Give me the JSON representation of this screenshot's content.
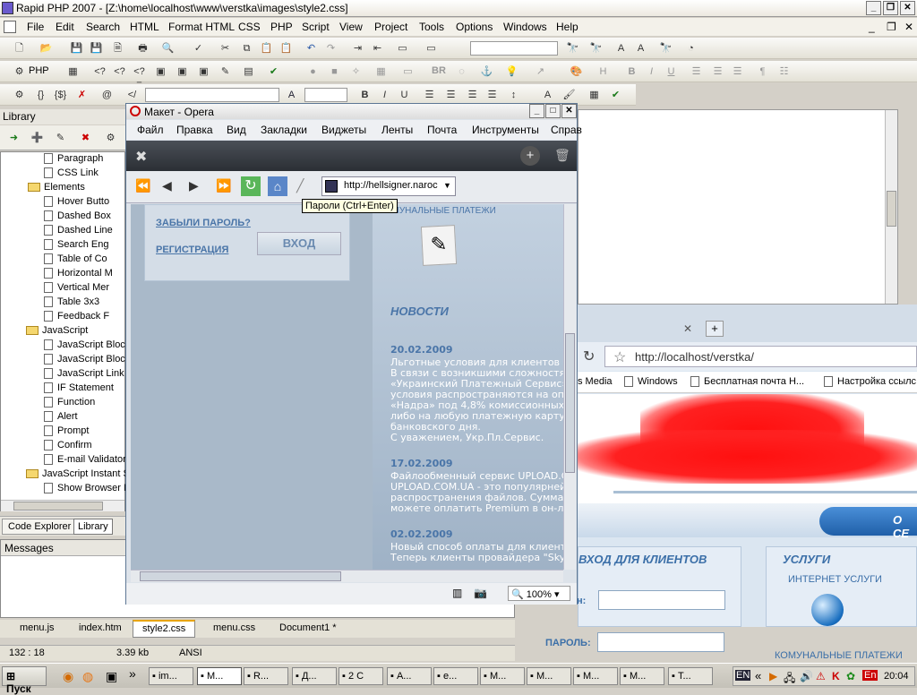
{
  "app": {
    "title": "Rapid PHP 2007 - [Z:\\home\\localhost\\www\\verstka\\images\\style2.css]",
    "menu": [
      "File",
      "Edit",
      "Search",
      "HTML",
      "Format HTML",
      "CSS",
      "PHP",
      "Script",
      "View",
      "Project",
      "Tools",
      "Options",
      "Windows",
      "Help"
    ],
    "toolbar2_labels": {
      "php": "PHP",
      "br": "BR"
    }
  },
  "library": {
    "title": "Library",
    "items": [
      {
        "label": "Paragraph",
        "type": "doc",
        "indent": 2
      },
      {
        "label": "CSS Link",
        "type": "doc",
        "indent": 2
      },
      {
        "label": "Elements",
        "type": "folder",
        "indent": 1
      },
      {
        "label": "Hover Butto",
        "type": "doc",
        "indent": 2
      },
      {
        "label": "Dashed Box",
        "type": "doc",
        "indent": 2
      },
      {
        "label": "Dashed Line",
        "type": "doc",
        "indent": 2
      },
      {
        "label": "Search Eng",
        "type": "doc",
        "indent": 2
      },
      {
        "label": "Table of Co",
        "type": "doc",
        "indent": 2
      },
      {
        "label": "Horizontal M",
        "type": "doc",
        "indent": 2
      },
      {
        "label": "Vertical Mer",
        "type": "doc",
        "indent": 2
      },
      {
        "label": "Table 3x3",
        "type": "doc",
        "indent": 2
      },
      {
        "label": "Feedback F",
        "type": "doc",
        "indent": 2
      },
      {
        "label": "JavaScript",
        "type": "folder",
        "indent": 0
      },
      {
        "label": "JavaScript Block",
        "type": "doc",
        "indent": 2
      },
      {
        "label": "JavaScript Block",
        "type": "doc",
        "indent": 2
      },
      {
        "label": "JavaScript Link",
        "type": "doc",
        "indent": 2
      },
      {
        "label": "IF Statement",
        "type": "doc",
        "indent": 2
      },
      {
        "label": "Function",
        "type": "doc",
        "indent": 2
      },
      {
        "label": "Alert",
        "type": "doc",
        "indent": 2
      },
      {
        "label": "Prompt",
        "type": "doc",
        "indent": 2
      },
      {
        "label": "Confirm",
        "type": "doc",
        "indent": 2
      },
      {
        "label": "E-mail Validator",
        "type": "doc",
        "indent": 2
      },
      {
        "label": "JavaScript Instant S",
        "type": "folder",
        "indent": 0
      },
      {
        "label": "Show Browser I",
        "type": "doc",
        "indent": 2
      }
    ],
    "bottom_tabs": [
      "Code Explorer",
      "Library"
    ]
  },
  "messages": {
    "title": "Messages"
  },
  "doc_tabs": [
    "menu.js",
    "index.htm",
    "style2.css",
    "menu.css",
    "Document1 *"
  ],
  "status": {
    "position": "132 : 18",
    "size": "3.39 kb",
    "encoding": "ANSI"
  },
  "opera": {
    "title": "Макет - Opera",
    "menu": [
      "Файл",
      "Правка",
      "Вид",
      "Закладки",
      "Виджеты",
      "Ленты",
      "Почта",
      "Инструменты",
      "Справ"
    ],
    "address": "http://hellsigner.naroc",
    "tooltip": "Пароли (Ctrl+Enter)",
    "zoom": "100%",
    "page": {
      "forgot": "ЗАБЫЛИ ПАРОЛЬ?",
      "register": "РЕГИСТРАЦИЯ",
      "login_btn": "ВХОД",
      "services_cut": "КОМУНАЛЬНЫЕ ПЛАТЕЖИ",
      "news_title": "НОВОСТИ",
      "news": [
        {
          "date": "20.02.2009",
          "lines": [
            "Льготные условия для клиентов Н",
            "В связи с возникшими сложностя",
            "«Украинский Платежный Сервис»",
            "условия распространяются на опе",
            "«Надра» под 4,8% комиссионных.",
            "либо на любую платежную карту У",
            "банковского дня.",
            "С уважением, Укр.Пл.Сервис."
          ]
        },
        {
          "date": "17.02.2009",
          "lines": [
            "Файлообменный сервис UPLOAD.C",
            "UPLOAD.COM.UA - это популярней",
            "распространения файлов. Суммар",
            "можете оплатить Premium в он-ла"
          ]
        },
        {
          "date": "02.02.2009",
          "lines": [
            "Новый способ оплаты для клиенто",
            "Теперь клиенты провайдера \"Skyr"
          ]
        }
      ]
    }
  },
  "browser2": {
    "address": "http://localhost/verstka/",
    "bookmarks": [
      "s Media",
      "Windows",
      "Бесплатная почта Н...",
      "Настройка ссылс"
    ],
    "banner_text": "О СЕ",
    "login_title": "ВХОД ДЛЯ КЛИЕНТОВ",
    "password_label": "ПАРОЛЬ:",
    "login_label_cut": "н:",
    "services_title": "УСЛУГИ",
    "service1": "ИНТЕРНЕТ УСЛУГИ",
    "service2": "КОМУНАЛЬНЫЕ ПЛАТЕЖИ"
  },
  "taskbar": {
    "start": "Пуск",
    "tasks": [
      "im...",
      "М...",
      "R...",
      "Д...",
      "2 С",
      "А...",
      "е...",
      "М...",
      "М...",
      "М...",
      "М...",
      "Т..."
    ],
    "clock": "20:04",
    "lang": "En",
    "chevron": "»"
  }
}
